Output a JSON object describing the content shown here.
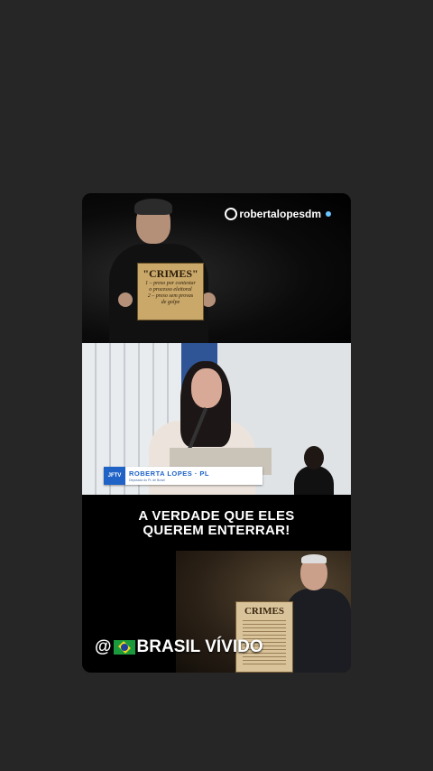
{
  "watermark": {
    "handle": "robertalopesdm"
  },
  "panel1": {
    "sign": {
      "title": "\"CRIMES\"",
      "line1": "1 – preso por contestar",
      "line2": "o processo eleitoral",
      "line3": "2 – preso sem provas",
      "line4": "de golpe"
    }
  },
  "panel2": {
    "lower_third": {
      "channel_logo": "JFTV",
      "name": "ROBERTA LOPES · PL",
      "subtitle": "Deputada do PL de Brasil"
    }
  },
  "panel3": {
    "headline_line1": "A VERDADE QUE ELES",
    "headline_line2": "QUEREM ENTERRAR!",
    "scroll_title": "CRIMES",
    "footer_at": "@",
    "footer_text": "BRASIL VÍVIDO"
  },
  "colors": {
    "background": "#262626",
    "accent_blue": "#1f63c7",
    "sign_paper": "#c9a86a"
  },
  "icons": {
    "watermark": "instagram-logo-icon",
    "flag": "brazil-flag-icon"
  }
}
